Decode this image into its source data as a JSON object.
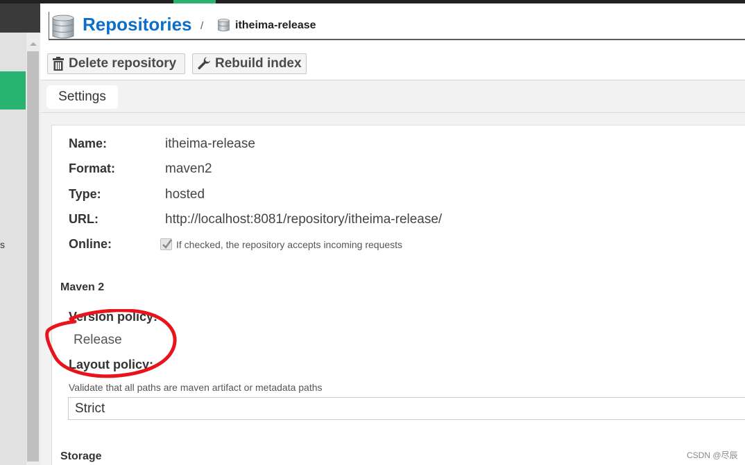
{
  "topbar": {
    "accent": "#2bb372"
  },
  "sidebar": {
    "fragment": "s",
    "active_color": "#28b470"
  },
  "header": {
    "title": "Repositories",
    "separator": "/",
    "breadcrumb": "itheima-release"
  },
  "toolbar": {
    "delete_label": "Delete repository",
    "rebuild_label": "Rebuild index"
  },
  "tabs": [
    {
      "label": "Settings",
      "active": true
    }
  ],
  "settings": {
    "fields": [
      {
        "label": "Name:",
        "value": "itheima-release"
      },
      {
        "label": "Format:",
        "value": "maven2"
      },
      {
        "label": "Type:",
        "value": "hosted"
      },
      {
        "label": "URL:",
        "value": "http://localhost:8081/repository/itheima-release/"
      }
    ],
    "online": {
      "label": "Online:",
      "checked": true,
      "help": "If checked, the repository accepts incoming requests"
    },
    "maven": {
      "section_title": "Maven 2",
      "version_policy_label": "Version policy:",
      "version_policy_value": "Release",
      "layout_policy_label": "Layout policy:",
      "layout_policy_help": "Validate that all paths are maven artifact or metadata paths",
      "layout_policy_value": "Strict"
    },
    "storage": {
      "section_title": "Storage"
    }
  },
  "annotation": {
    "color": "#e8141c",
    "target": "Version policy: Release"
  },
  "watermark": "CSDN @尽辰"
}
